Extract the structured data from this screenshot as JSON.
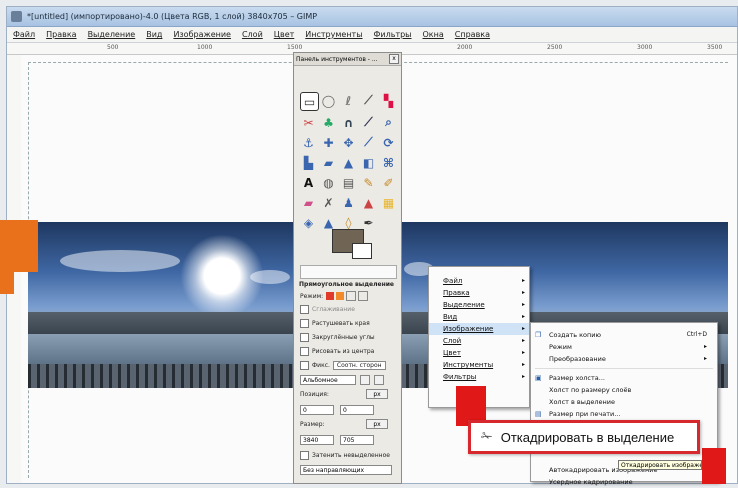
{
  "window": {
    "title": "*[untitled] (импортировано)-4.0 (Цвета RGB, 1 слой) 3840x705 – GIMP"
  },
  "menubar": [
    "Файл",
    "Правка",
    "Выделение",
    "Вид",
    "Изображение",
    "Слой",
    "Цвет",
    "Инструменты",
    "Фильтры",
    "Окна",
    "Справка"
  ],
  "ruler": [
    "500",
    "1000",
    "1500",
    "2000",
    "2500",
    "3000",
    "3500"
  ],
  "toolbox": {
    "title": "Панель инструментов - ...",
    "close": "x",
    "options_title": "Прямоугольное выделение",
    "mode_label": "Режим:",
    "options": [
      "Сглаживание",
      "Растушевать края",
      "Закруглённые углы",
      "Рисовать из центра"
    ],
    "fixed_label": "Фикс.",
    "fixed_value": "Соотн. сторон",
    "aspect_value": "Альбомное",
    "position_label": "Позиция:",
    "position_unit": "px",
    "position_x": "0",
    "position_y": "0",
    "size_label": "Размер:",
    "size_unit": "px",
    "size_w": "3840",
    "size_h": "705",
    "highlight_label": "Затенить невыделенное",
    "guides_value": "Без направляющих"
  },
  "context_menu": {
    "items": [
      "Файл",
      "Правка",
      "Выделение",
      "Вид",
      "Изображение",
      "Слой",
      "Цвет",
      "Инструменты",
      "Фильтры"
    ],
    "selected": "Изображение"
  },
  "image_submenu": {
    "items": [
      {
        "label": "Создать копию",
        "shortcut": "Ctrl+D"
      },
      {
        "label": "Режим",
        "shortcut": ""
      },
      {
        "label": "Преобразование",
        "shortcut": ""
      },
      {
        "label": "Размер холста...",
        "shortcut": ""
      },
      {
        "label": "Холст по размеру слоёв",
        "shortcut": ""
      },
      {
        "label": "Холст в выделение",
        "shortcut": ""
      },
      {
        "label": "Размер при печати...",
        "shortcut": ""
      }
    ],
    "bottom_items": [
      "Автокадрировать изображение",
      "Усердное кадрирование"
    ]
  },
  "callout": {
    "label": "Откадрировать в выделение"
  },
  "tooltip": {
    "text": "Откадрировать изображение"
  },
  "colors": {
    "accent_red": "#e01818",
    "accent_orange": "#e9711c",
    "foreground_color": "#706455"
  }
}
